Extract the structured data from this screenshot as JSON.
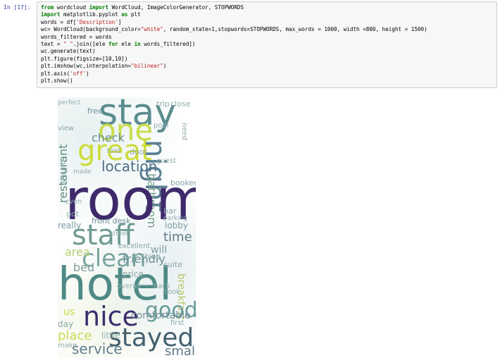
{
  "cell": {
    "prompt": "In [17]:",
    "code_lines": [
      [
        {
          "t": "from",
          "c": "kw"
        },
        {
          "t": " wordcloud ",
          "c": ""
        },
        {
          "t": "import",
          "c": "kw"
        },
        {
          "t": " WordCloud, ImageColorGenerator, STOPWORDS",
          "c": ""
        }
      ],
      [
        {
          "t": "import",
          "c": "kw"
        },
        {
          "t": " matplotlib.pyplot ",
          "c": ""
        },
        {
          "t": "as",
          "c": "kw"
        },
        {
          "t": " plt",
          "c": ""
        }
      ],
      [
        {
          "t": "words = df[",
          "c": ""
        },
        {
          "t": "'Description'",
          "c": "st"
        },
        {
          "t": "]",
          "c": ""
        }
      ],
      [
        {
          "t": "wc= WordCloud(background_color=",
          "c": ""
        },
        {
          "t": "\"white\"",
          "c": "st"
        },
        {
          "t": ", random_state=1,stopwords=STOPWORDS, max_words = 1000, width =800, height = 1500)",
          "c": ""
        }
      ],
      [
        {
          "t": "words_filtered = words",
          "c": ""
        }
      ],
      [
        {
          "t": "text = ",
          "c": ""
        },
        {
          "t": "\" \"",
          "c": "st"
        },
        {
          "t": ".join([ele ",
          "c": ""
        },
        {
          "t": "for",
          "c": "kw"
        },
        {
          "t": " ele ",
          "c": ""
        },
        {
          "t": "in",
          "c": "kw"
        },
        {
          "t": " words_filtered])",
          "c": ""
        }
      ],
      [
        {
          "t": "wc.generate(text)",
          "c": ""
        }
      ],
      [
        {
          "t": "plt.figure(figsize=[10,10])",
          "c": ""
        }
      ],
      [
        {
          "t": "plt.imshow(wc,interpolation=",
          "c": ""
        },
        {
          "t": "\"bilinear\"",
          "c": "st"
        },
        {
          "t": ")",
          "c": ""
        }
      ],
      [
        {
          "t": "plt.axis(",
          "c": ""
        },
        {
          "t": "'off'",
          "c": "st"
        },
        {
          "t": ")",
          "c": ""
        }
      ],
      [
        {
          "t": "plt.show()",
          "c": ""
        }
      ]
    ]
  },
  "wordcloud": {
    "words": [
      {
        "text": "stay",
        "color": "#5b8c8e"
      },
      {
        "text": "one",
        "color": "#c9dd4a"
      },
      {
        "text": "great",
        "color": "#cddc39"
      },
      {
        "text": "night",
        "color": "#5a7f94"
      },
      {
        "text": "location",
        "color": "#4e6d84"
      },
      {
        "text": "restaurant",
        "color": "#5f8b80"
      },
      {
        "text": "check",
        "color": "#6a8f9a"
      },
      {
        "text": "bathroom",
        "color": "#7aa08a"
      },
      {
        "text": "room",
        "color": "#3e2a6b"
      },
      {
        "text": "staff",
        "color": "#6f9a92"
      },
      {
        "text": "clean",
        "color": "#7aa7a0"
      },
      {
        "text": "time",
        "color": "#5d7b88"
      },
      {
        "text": "breakfast",
        "color": "#b9c96a"
      },
      {
        "text": "friendly",
        "color": "#6b8d94"
      },
      {
        "text": "hotel",
        "color": "#4e8a86"
      },
      {
        "text": "nice",
        "color": "#3b2d6e"
      },
      {
        "text": "good",
        "color": "#6a9b9a"
      },
      {
        "text": "stayed",
        "color": "#44606f"
      },
      {
        "text": "comfortable",
        "color": "#6f8f99"
      },
      {
        "text": "service",
        "color": "#627f8c"
      },
      {
        "text": "small",
        "color": "#5c7c88"
      },
      {
        "text": "place",
        "color": "#cbdc58"
      },
      {
        "text": "us",
        "color": "#c9dc47"
      },
      {
        "text": "day",
        "color": "#8aa5a5"
      },
      {
        "text": "bed",
        "color": "#7f9ea0"
      },
      {
        "text": "area",
        "color": "#b5cf73"
      },
      {
        "text": "really",
        "color": "#7c9aa4"
      },
      {
        "text": "lobby",
        "color": "#7d9ca4"
      },
      {
        "text": "front desk",
        "color": "#6c8e96"
      },
      {
        "text": "will",
        "color": "#7e9ca6"
      },
      {
        "text": "price",
        "color": "#8aa7a8"
      },
      {
        "text": "little",
        "color": "#94aeb0"
      },
      {
        "text": "excellent",
        "color": "#8aa6a8"
      },
      {
        "text": "free",
        "color": "#6f8d98"
      },
      {
        "text": "door",
        "color": "#8ca6aa"
      },
      {
        "text": "booked",
        "color": "#86a3a8"
      },
      {
        "text": "bar",
        "color": "#8aa5a8"
      },
      {
        "text": "suite",
        "color": "#8da8ab"
      },
      {
        "text": "thing",
        "color": "#8ca7aa"
      },
      {
        "text": "even",
        "color": "#94adaf"
      },
      {
        "text": "got",
        "color": "#91abad"
      },
      {
        "text": "make",
        "color": "#93acae"
      },
      {
        "text": "first",
        "color": "#8fa9ab"
      },
      {
        "text": "parking",
        "color": "#8ea9ab"
      },
      {
        "text": "street",
        "color": "#90aaac"
      },
      {
        "text": "guest",
        "color": "#93acae"
      },
      {
        "text": "need",
        "color": "#92abad"
      },
      {
        "text": "made",
        "color": "#93acae"
      },
      {
        "text": "around",
        "color": "#91abad"
      },
      {
        "text": "view",
        "color": "#8aa5a8"
      },
      {
        "text": "pool",
        "color": "#90a9ab"
      },
      {
        "text": "trip",
        "color": "#94adaf"
      },
      {
        "text": "close",
        "color": "#8fa9ab"
      },
      {
        "text": "told",
        "color": "#95aeb0"
      },
      {
        "text": "overall",
        "color": "#96afb1"
      },
      {
        "text": "perfect",
        "color": "#93acae"
      },
      {
        "text": "back",
        "color": "#91abad"
      },
      {
        "text": "took",
        "color": "#94adaf"
      }
    ]
  }
}
